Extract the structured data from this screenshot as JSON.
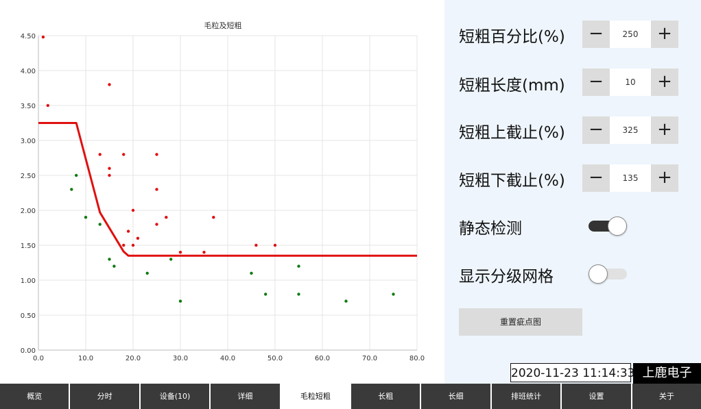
{
  "settings": [
    {
      "label": "短粗百分比(%)",
      "value": "250",
      "minus": "−",
      "plus": "+"
    },
    {
      "label": "短粗长度(mm)",
      "value": "10",
      "minus": "−",
      "plus": "+"
    },
    {
      "label": "短粗上截止(%)",
      "value": "325",
      "minus": "−",
      "plus": "+"
    },
    {
      "label": "短粗下截止(%)",
      "value": "135",
      "minus": "−",
      "plus": "+"
    }
  ],
  "toggles": [
    {
      "label": "静态检测",
      "state": "on"
    },
    {
      "label": "显示分级网格",
      "state": "off"
    }
  ],
  "reset_button": "重置疵点图",
  "datetime": "2020-11-23 11:14:33",
  "brand": "上鹿电子",
  "tabs": [
    {
      "label": "概览",
      "active": false
    },
    {
      "label": "分时",
      "active": false
    },
    {
      "label": "设备(10)",
      "active": false
    },
    {
      "label": "详细",
      "active": false
    },
    {
      "label": "毛粒短粗",
      "active": true
    },
    {
      "label": "长粗",
      "active": false
    },
    {
      "label": "长细",
      "active": false
    },
    {
      "label": "排班统计",
      "active": false
    },
    {
      "label": "设置",
      "active": false
    },
    {
      "label": "关于",
      "active": false
    }
  ],
  "chart_data": {
    "type": "scatter",
    "title": "毛粒及短粗",
    "xlabel": "",
    "ylabel": "",
    "xlim": [
      0,
      80
    ],
    "ylim": [
      0,
      4.5
    ],
    "x_ticks": [
      "0.0",
      "10.0",
      "20.0",
      "30.0",
      "40.0",
      "50.0",
      "60.0",
      "70.0",
      "80.0"
    ],
    "y_ticks": [
      "0.00",
      "0.50",
      "1.00",
      "1.50",
      "2.00",
      "2.50",
      "3.00",
      "3.50",
      "4.00",
      "4.50"
    ],
    "grid": true,
    "series": [
      {
        "color": "#e01010",
        "points": [
          [
            1,
            4.48
          ],
          [
            2,
            3.5
          ],
          [
            13,
            2.8
          ],
          [
            15,
            3.8
          ],
          [
            15,
            2.6
          ],
          [
            15,
            2.5
          ],
          [
            18,
            2.8
          ],
          [
            18,
            1.5
          ],
          [
            19,
            1.7
          ],
          [
            20,
            2.0
          ],
          [
            20,
            1.5
          ],
          [
            21,
            1.6
          ],
          [
            25,
            2.8
          ],
          [
            25,
            2.3
          ],
          [
            25,
            1.8
          ],
          [
            27,
            1.9
          ],
          [
            30,
            1.4
          ],
          [
            35,
            1.4
          ],
          [
            37,
            1.9
          ],
          [
            46,
            1.5
          ],
          [
            50,
            1.5
          ]
        ]
      },
      {
        "color": "#117a11",
        "points": [
          [
            7,
            2.3
          ],
          [
            8,
            2.5
          ],
          [
            10,
            1.9
          ],
          [
            13,
            1.8
          ],
          [
            15,
            1.3
          ],
          [
            16,
            1.2
          ],
          [
            23,
            1.1
          ],
          [
            28,
            1.3
          ],
          [
            30,
            0.7
          ],
          [
            45,
            1.1
          ],
          [
            48,
            0.8
          ],
          [
            55,
            1.2
          ],
          [
            55,
            0.8
          ],
          [
            65,
            0.7
          ],
          [
            75,
            0.8
          ]
        ]
      }
    ],
    "threshold_line": {
      "color": "#e01010",
      "points": [
        [
          0,
          3.25
        ],
        [
          8,
          3.25
        ],
        [
          13,
          1.97
        ],
        [
          18,
          1.41
        ],
        [
          19,
          1.35
        ],
        [
          80,
          1.35
        ]
      ]
    }
  }
}
